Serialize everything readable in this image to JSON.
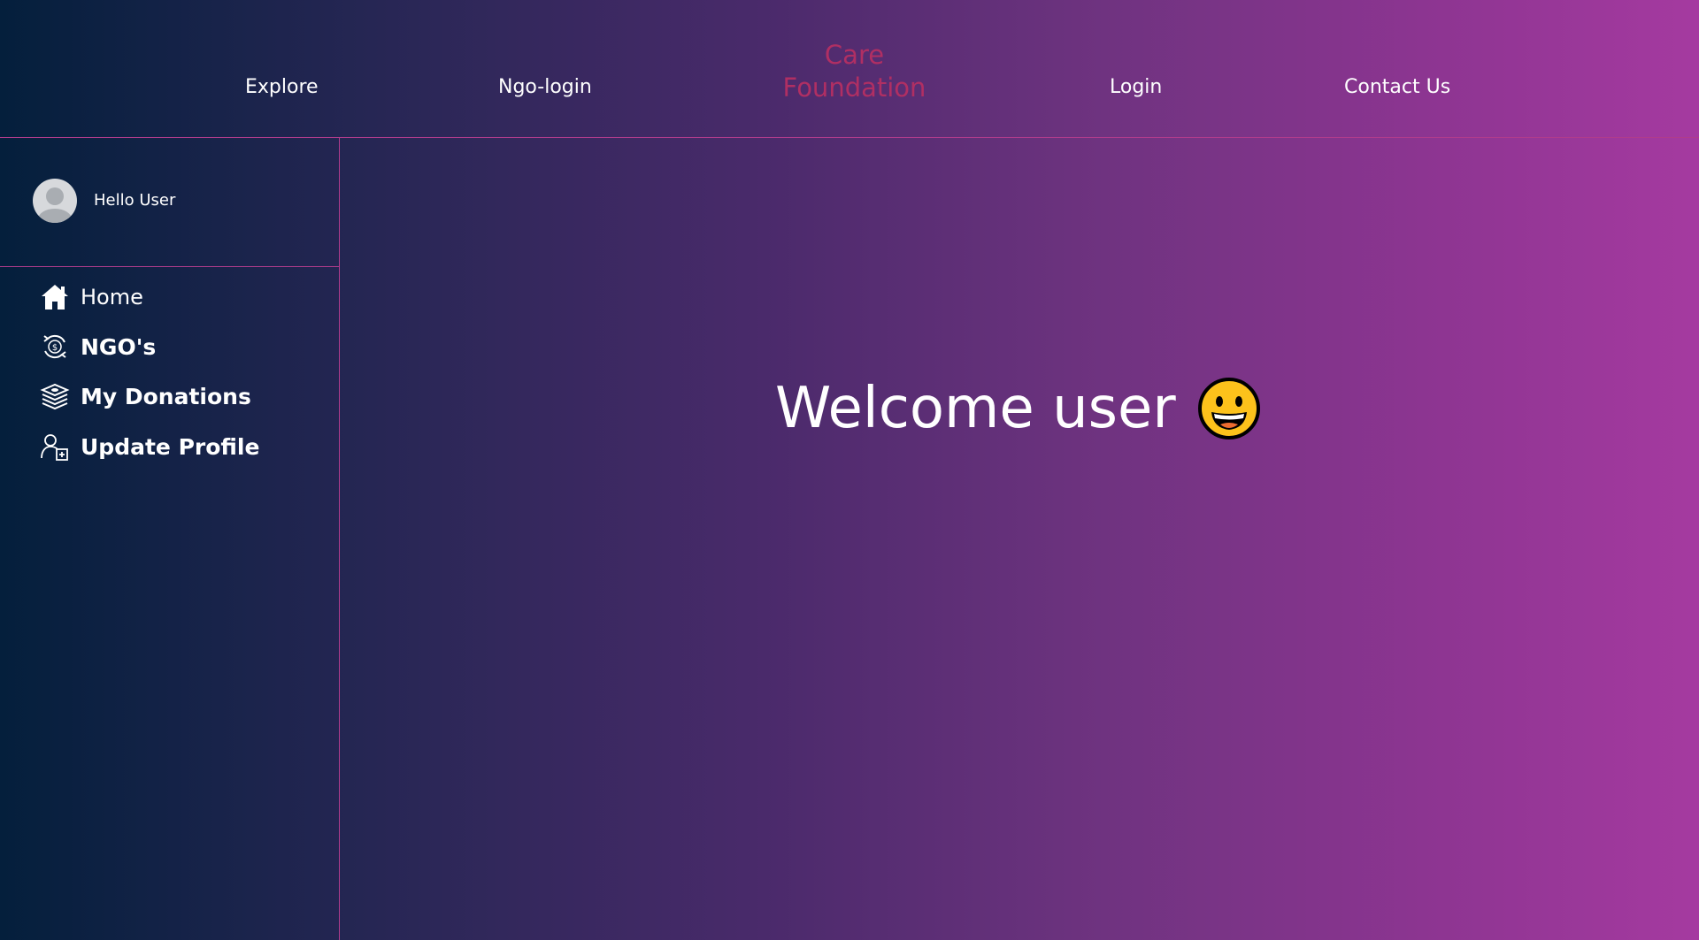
{
  "nav": {
    "explore": "Explore",
    "ngo_login": "Ngo-login",
    "brand_line1": "Care",
    "brand_line2": "Foundation",
    "login": "Login",
    "contact": "Contact Us"
  },
  "colors": {
    "brand": "#b02f63",
    "divider": "#b03c8c",
    "gradient_start": "#041f3c",
    "gradient_end": "#a53aa0"
  },
  "sidebar": {
    "greeting": "Hello User",
    "items": [
      {
        "label": "Home",
        "icon": "home-icon"
      },
      {
        "label": "NGO's",
        "icon": "donate-cycle-icon"
      },
      {
        "label": "My Donations",
        "icon": "money-stack-icon"
      },
      {
        "label": "Update Profile",
        "icon": "user-add-icon"
      }
    ]
  },
  "main": {
    "welcome": "Welcome user",
    "emoji": "grinning-face-emoji"
  }
}
